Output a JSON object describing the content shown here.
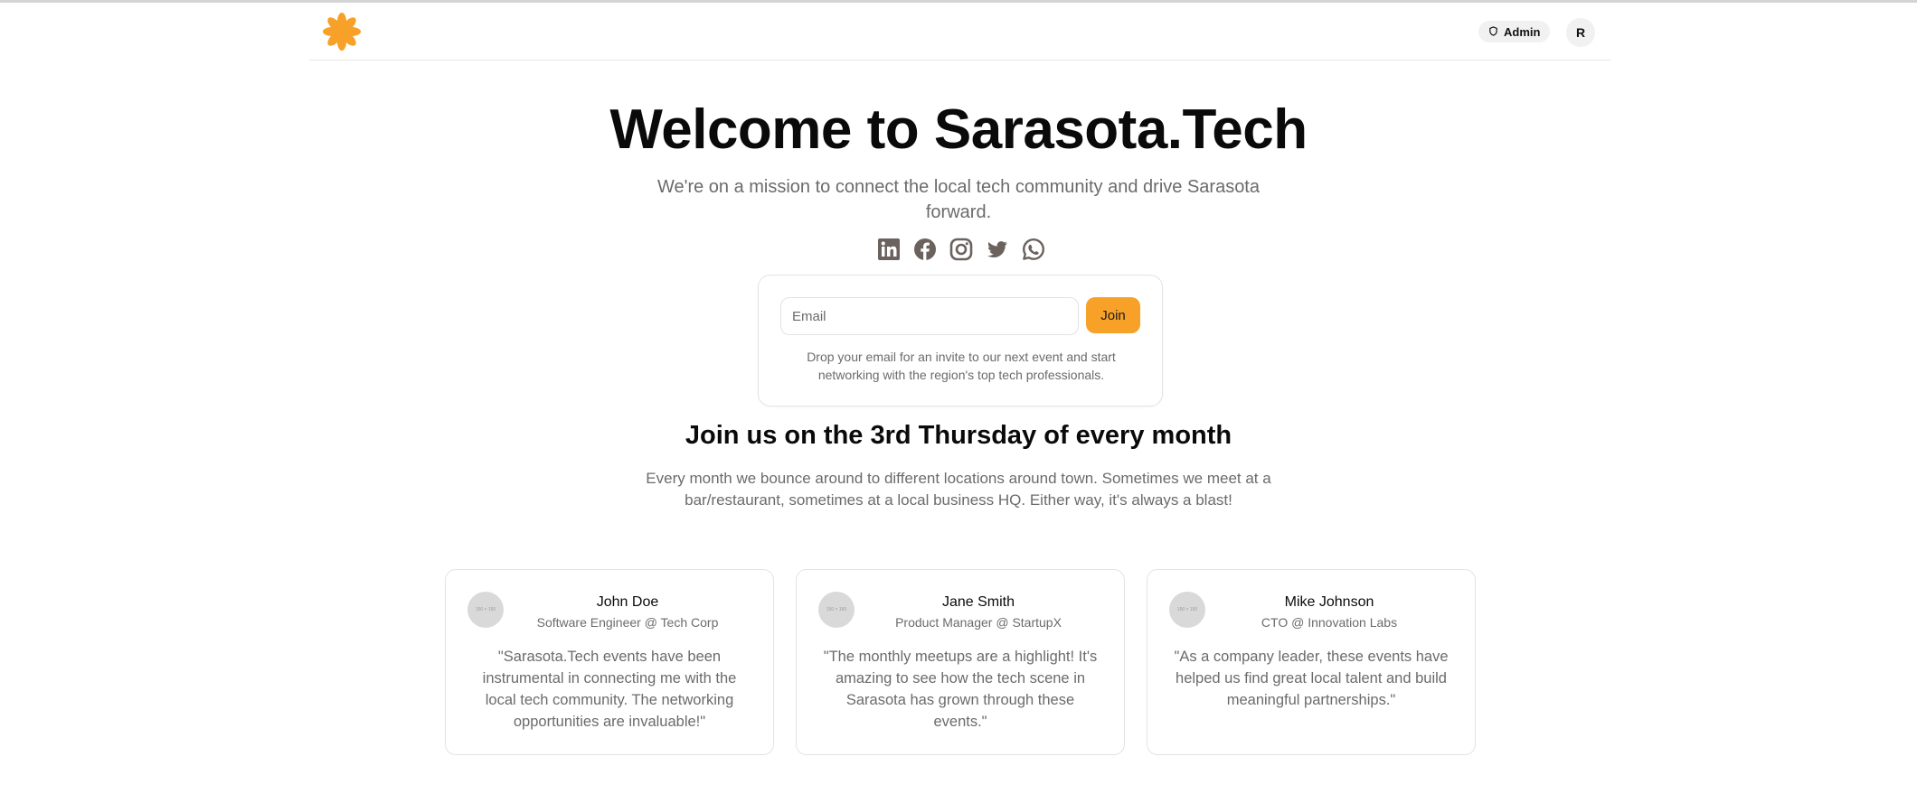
{
  "header": {
    "logo_icon": "asterisk-flower-icon",
    "brand_color": "#f7a128",
    "admin_label": "Admin",
    "avatar_initial": "R"
  },
  "hero": {
    "title": "Welcome to Sarasota.Tech",
    "subtitle": "We're on a mission to connect the local tech community and drive Sarasota forward."
  },
  "socials": [
    "linkedin-icon",
    "facebook-icon",
    "instagram-icon",
    "twitter-icon",
    "whatsapp-icon"
  ],
  "signup": {
    "email_placeholder": "Email",
    "email_value": "",
    "join_label": "Join",
    "note": "Drop your email for an invite to our next event and start networking with the region's top tech professionals."
  },
  "meetup": {
    "title": "Join us on the 3rd Thursday of every month",
    "description": "Every month we bounce around to different locations around town. Sometimes we meet at a bar/restaurant, sometimes at a local business HQ. Either way, it's always a blast!"
  },
  "testimonials": [
    {
      "avatar_text": "150 × 150",
      "name": "John Doe",
      "role": "Software Engineer @ Tech Corp",
      "quote": "\"Sarasota.Tech events have been instrumental in connecting me with the local tech community. The networking opportunities are invaluable!\""
    },
    {
      "avatar_text": "150 × 150",
      "name": "Jane Smith",
      "role": "Product Manager @ StartupX",
      "quote": "\"The monthly meetups are a highlight! It's amazing to see how the tech scene in Sarasota has grown through these events.\""
    },
    {
      "avatar_text": "150 × 150",
      "name": "Mike Johnson",
      "role": "CTO @ Innovation Labs",
      "quote": "\"As a company leader, these events have helped us find great local talent and build meaningful partnerships.\""
    }
  ]
}
